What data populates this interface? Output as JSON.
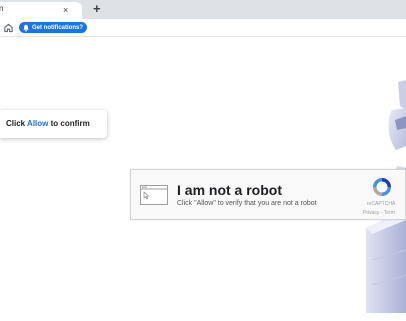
{
  "browser": {
    "tab": {
      "title": "n",
      "close_glyph": "×"
    },
    "new_tab_glyph": "+",
    "toolbar": {
      "home_icon": "home-icon",
      "notification_button": {
        "icon": "bell-icon",
        "label": "Get notifications?"
      }
    }
  },
  "prompt": {
    "prefix": "Click ",
    "highlight": "Allow",
    "suffix": " to confirm"
  },
  "captcha": {
    "title": "I am not a robot",
    "subtitle": "Click \"Allow\" to verify that you are not a robot",
    "brand": "reCAPTCHA",
    "links": "Privacy - Term"
  },
  "colors": {
    "accent": "#1a73e8",
    "tabbar": "#dee1e6"
  }
}
